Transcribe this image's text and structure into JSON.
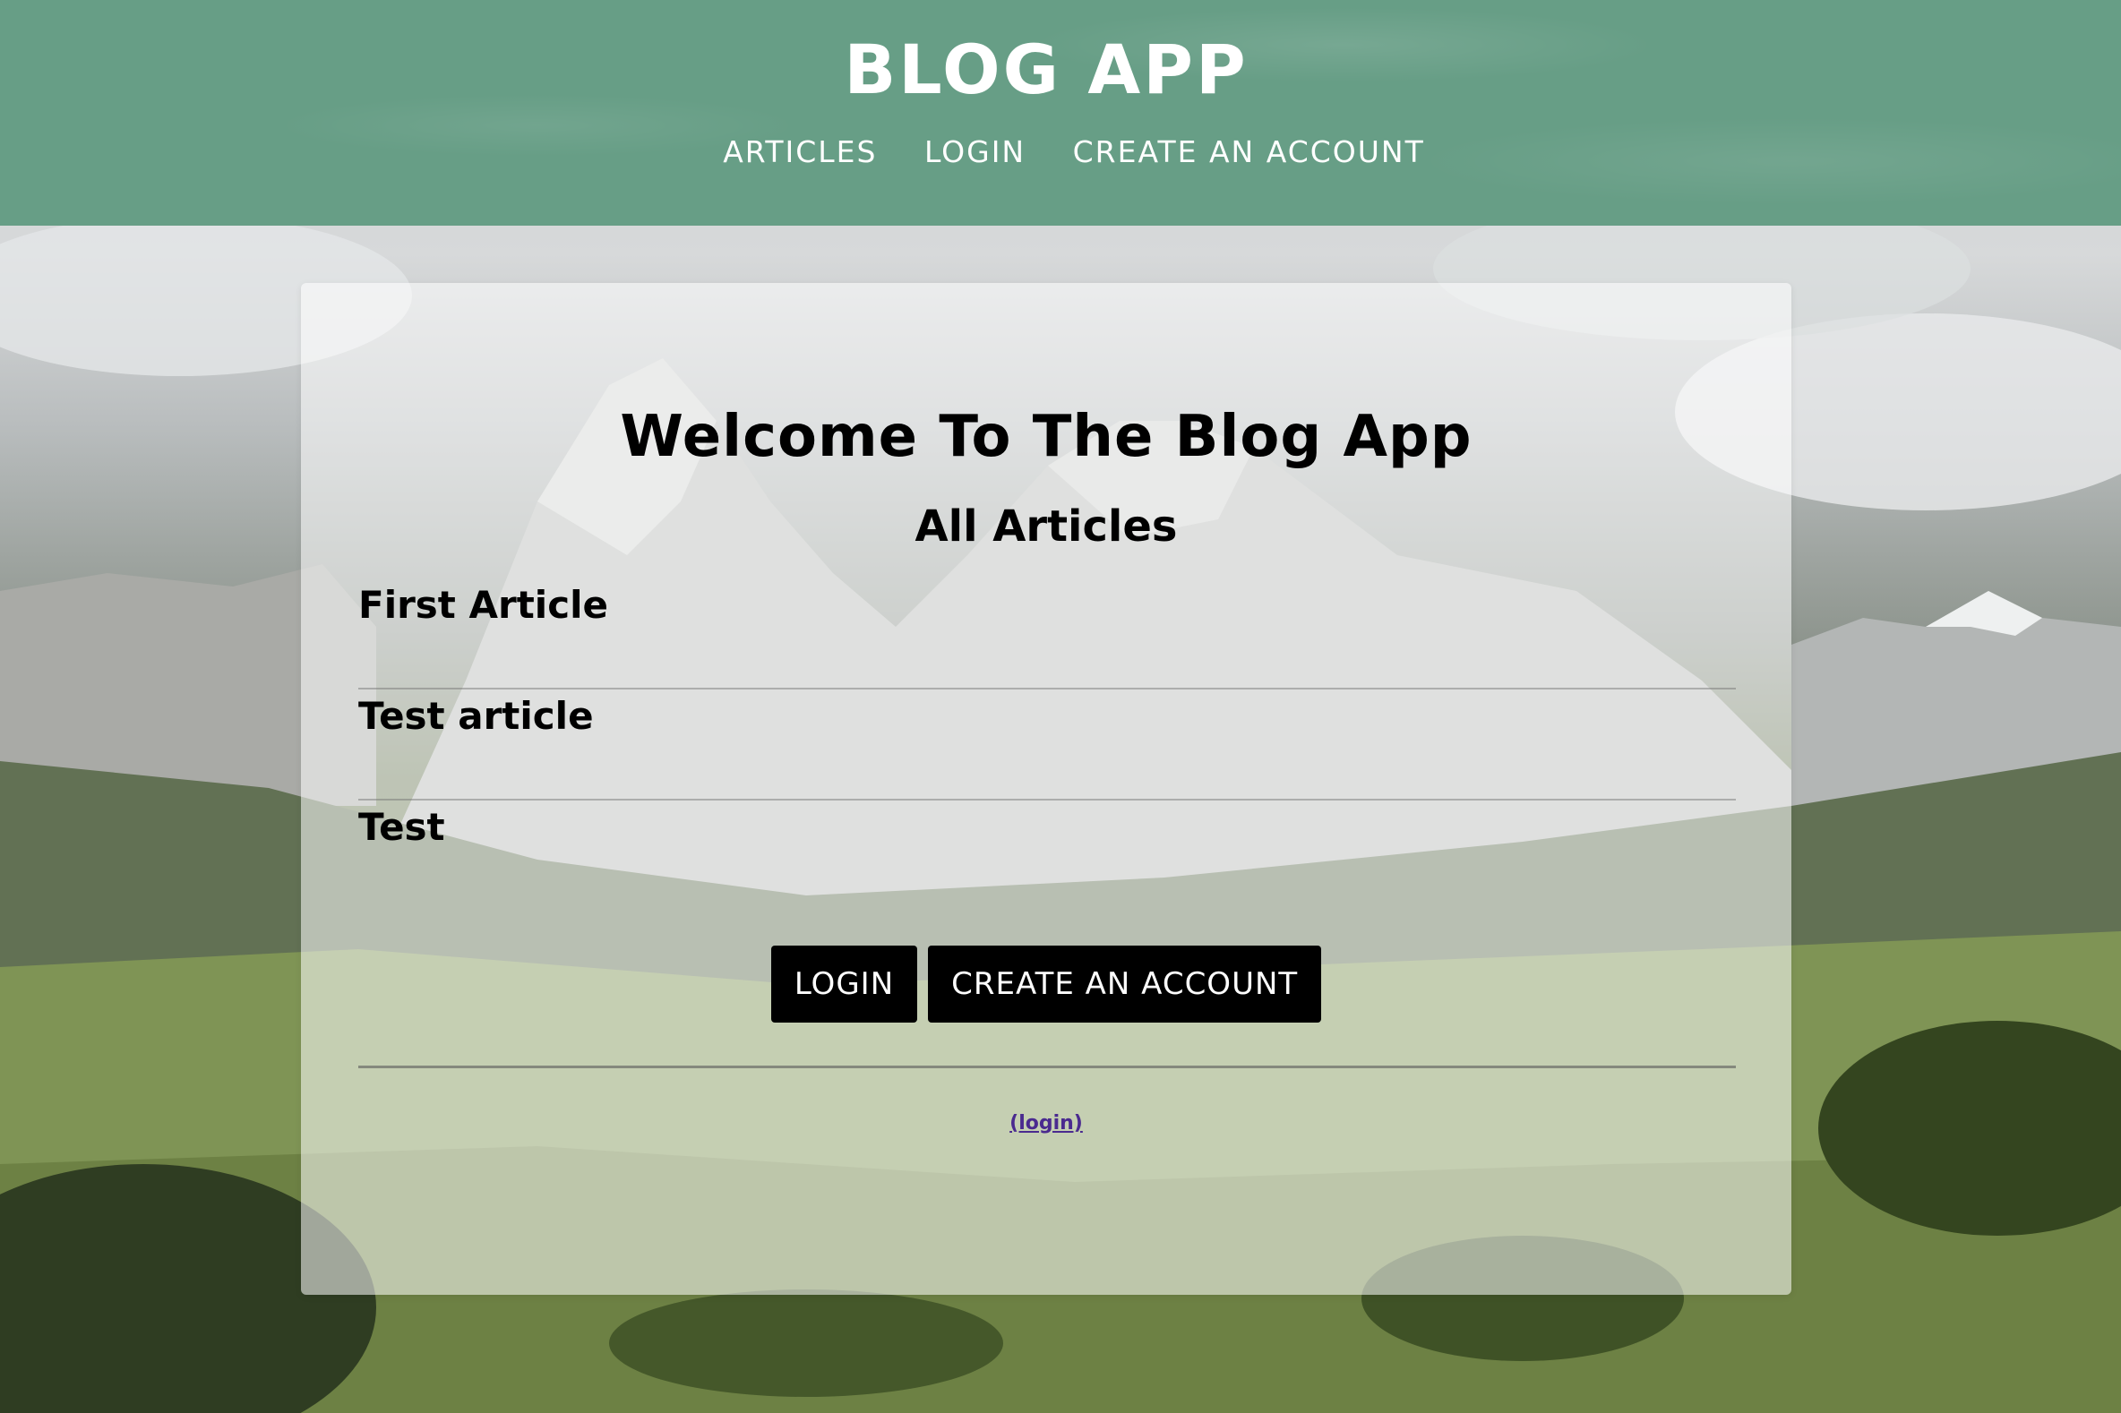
{
  "header": {
    "site_title": "BLOG APP",
    "nav": [
      {
        "label": "ARTICLES"
      },
      {
        "label": "LOGIN"
      },
      {
        "label": "CREATE AN ACCOUNT"
      }
    ]
  },
  "main": {
    "welcome_title": "Welcome To The Blog App",
    "articles_heading": "All Articles",
    "articles": [
      {
        "title": "First Article"
      },
      {
        "title": "Test article"
      },
      {
        "title": "Test"
      }
    ],
    "buttons": {
      "login_label": "LOGIN",
      "create_account_label": "CREATE AN ACCOUNT"
    },
    "footer_link": "(login)"
  },
  "colors": {
    "header_bg": "#679e86",
    "button_bg": "#000000",
    "link_color": "#4a2a8f"
  }
}
